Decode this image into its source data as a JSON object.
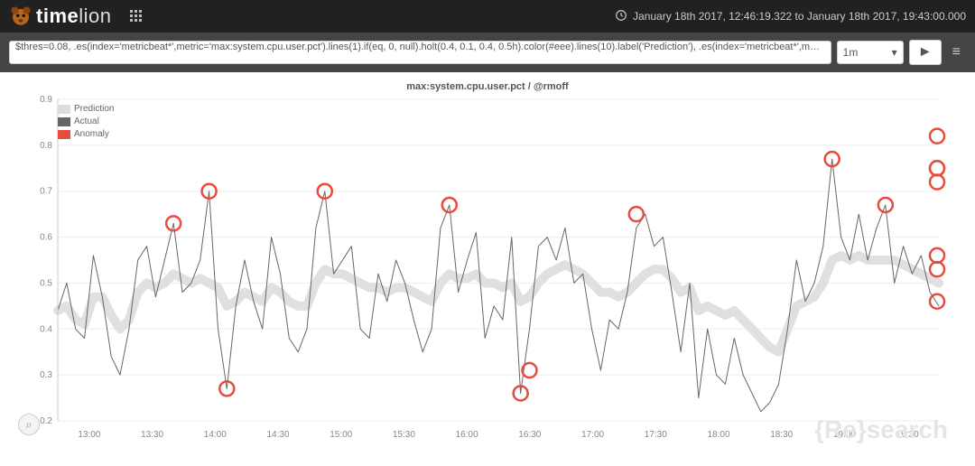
{
  "header": {
    "app_name_prefix": "time",
    "app_name_suffix": "lion",
    "time_range": "January 18th 2017, 12:46:19.322 to January 18th 2017, 19:43:00.000"
  },
  "querybar": {
    "expression": "$thres=0.08, .es(index='metricbeat*',metric='max:system.cpu.user.pct').lines(1).if(eq, 0, null).holt(0.4, 0.1, 0.4, 0.5h).color(#eee).lines(10).label('Prediction'), .es(index='metricbeat*',metric…",
    "interval": "1m",
    "run_icon": "►",
    "menu_icon": "≡"
  },
  "legend": {
    "prediction": "Prediction",
    "actual": "Actual",
    "anomaly": "Anomaly"
  },
  "watermark": "{Re}search",
  "chart_data": {
    "type": "line",
    "title": "max:system.cpu.user.pct / @rmoff",
    "xlabel": "",
    "ylabel": "",
    "ylim": [
      0.2,
      0.9
    ],
    "x_ticks": [
      "13:00",
      "13:30",
      "14:00",
      "14:30",
      "15:00",
      "15:30",
      "16:00",
      "16:30",
      "17:00",
      "17:30",
      "18:00",
      "18:30",
      "19:00",
      "19:30"
    ],
    "y_ticks": [
      0.2,
      0.3,
      0.4,
      0.5,
      0.6,
      0.7,
      0.8,
      0.9
    ],
    "series": [
      {
        "name": "Prediction",
        "color": "#dddddd",
        "stroke_width": 10,
        "values": [
          0.44,
          0.45,
          0.42,
          0.41,
          0.47,
          0.47,
          0.43,
          0.4,
          0.42,
          0.48,
          0.5,
          0.49,
          0.5,
          0.52,
          0.51,
          0.5,
          0.51,
          0.5,
          0.49,
          0.45,
          0.46,
          0.48,
          0.47,
          0.46,
          0.49,
          0.48,
          0.46,
          0.45,
          0.45,
          0.5,
          0.53,
          0.52,
          0.52,
          0.51,
          0.5,
          0.49,
          0.49,
          0.48,
          0.49,
          0.49,
          0.48,
          0.47,
          0.46,
          0.5,
          0.52,
          0.51,
          0.51,
          0.52,
          0.5,
          0.5,
          0.49,
          0.5,
          0.46,
          0.47,
          0.5,
          0.52,
          0.53,
          0.54,
          0.53,
          0.52,
          0.5,
          0.48,
          0.48,
          0.47,
          0.48,
          0.5,
          0.52,
          0.53,
          0.53,
          0.51,
          0.48,
          0.49,
          0.44,
          0.45,
          0.44,
          0.43,
          0.44,
          0.42,
          0.4,
          0.38,
          0.36,
          0.35,
          0.4,
          0.45,
          0.46,
          0.47,
          0.5,
          0.55,
          0.56,
          0.55,
          0.56,
          0.55,
          0.55,
          0.55,
          0.55,
          0.54,
          0.53,
          0.52,
          0.51,
          0.5
        ]
      },
      {
        "name": "Actual",
        "color": "#666666",
        "stroke_width": 1,
        "values": [
          0.44,
          0.5,
          0.4,
          0.38,
          0.56,
          0.47,
          0.34,
          0.3,
          0.4,
          0.55,
          0.58,
          0.47,
          0.55,
          0.63,
          0.48,
          0.5,
          0.55,
          0.7,
          0.4,
          0.27,
          0.45,
          0.55,
          0.46,
          0.4,
          0.6,
          0.52,
          0.38,
          0.35,
          0.4,
          0.62,
          0.7,
          0.52,
          0.55,
          0.58,
          0.4,
          0.38,
          0.52,
          0.46,
          0.55,
          0.5,
          0.42,
          0.35,
          0.4,
          0.62,
          0.67,
          0.48,
          0.55,
          0.61,
          0.38,
          0.45,
          0.42,
          0.6,
          0.26,
          0.4,
          0.58,
          0.6,
          0.55,
          0.62,
          0.5,
          0.52,
          0.4,
          0.31,
          0.42,
          0.4,
          0.48,
          0.62,
          0.65,
          0.58,
          0.6,
          0.48,
          0.35,
          0.5,
          0.25,
          0.4,
          0.3,
          0.28,
          0.38,
          0.3,
          0.26,
          0.22,
          0.24,
          0.28,
          0.4,
          0.55,
          0.46,
          0.5,
          0.58,
          0.77,
          0.6,
          0.55,
          0.65,
          0.55,
          0.62,
          0.67,
          0.5,
          0.58,
          0.52,
          0.56,
          0.48,
          0.45
        ]
      }
    ],
    "anomalies": [
      {
        "x_index": 13,
        "y": 0.63
      },
      {
        "x_index": 17,
        "y": 0.7
      },
      {
        "x_index": 19,
        "y": 0.27
      },
      {
        "x_index": 30,
        "y": 0.7
      },
      {
        "x_index": 44,
        "y": 0.67
      },
      {
        "x_index": 52,
        "y": 0.26
      },
      {
        "x_index": 53,
        "y": 0.31
      },
      {
        "x_index": 65,
        "y": 0.65
      },
      {
        "x_index": 87,
        "y": 0.77
      },
      {
        "x_index": 93,
        "y": 0.67
      }
    ],
    "anomalies_right_edge": [
      {
        "y": 0.56
      },
      {
        "y": 0.72
      },
      {
        "y": 0.75
      },
      {
        "y": 0.53
      },
      {
        "y": 0.82
      },
      {
        "y": 0.75
      },
      {
        "y": 0.46
      }
    ]
  }
}
